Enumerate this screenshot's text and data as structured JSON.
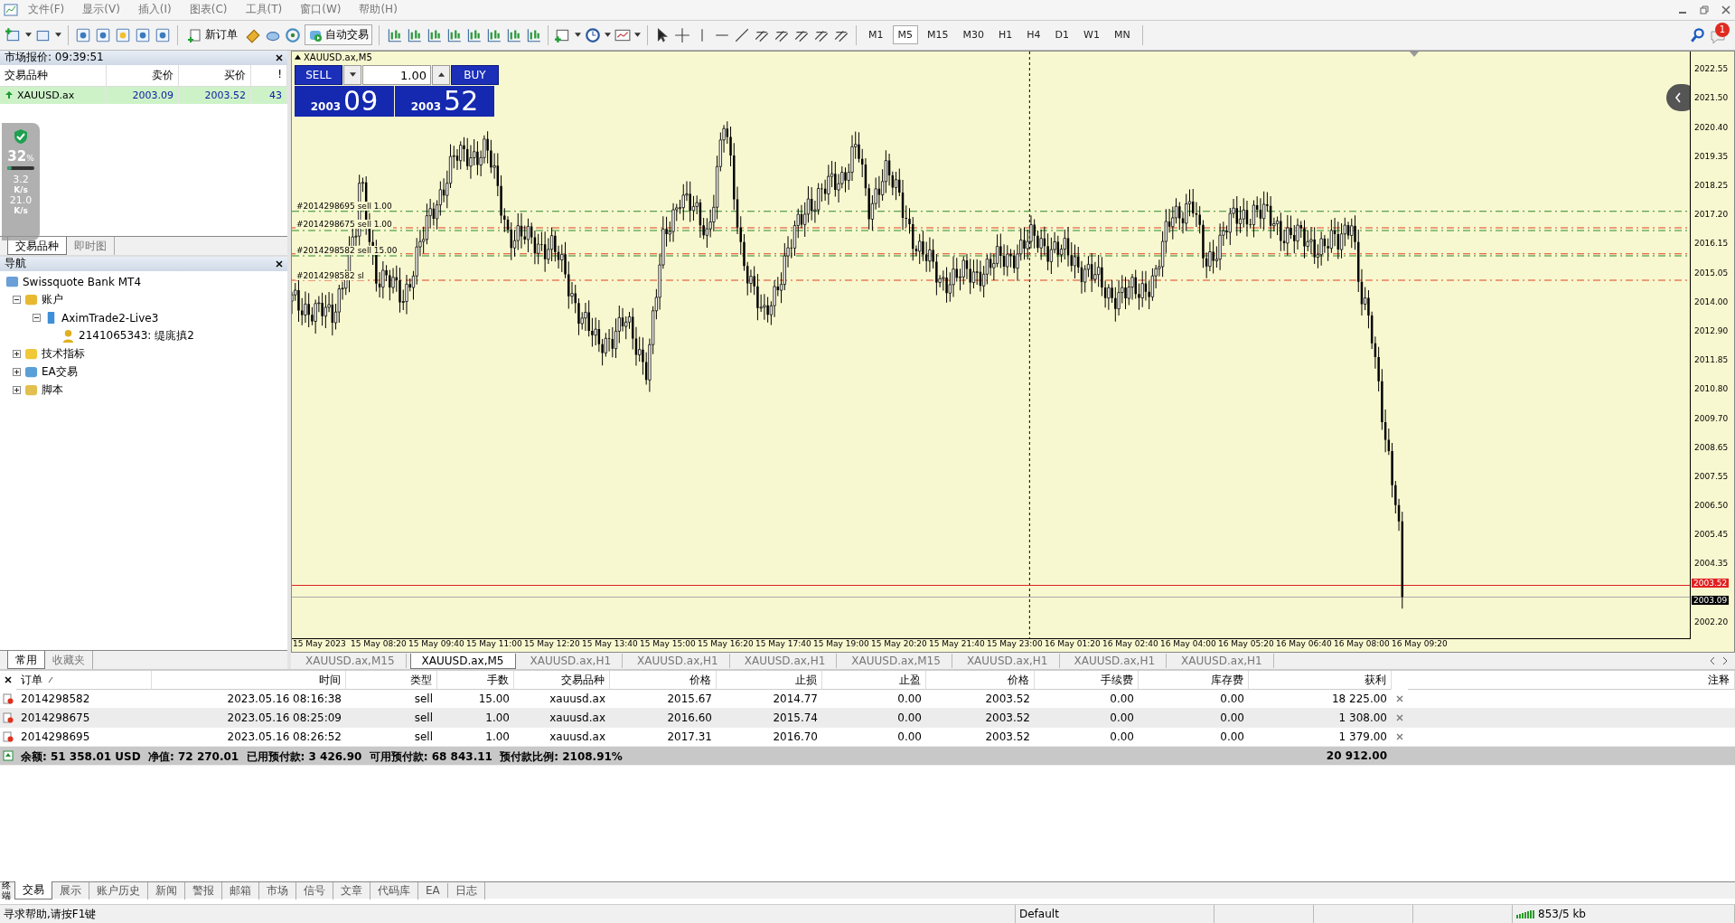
{
  "menu": [
    "文件(F)",
    "显示(V)",
    "插入(I)",
    "图表(C)",
    "工具(T)",
    "窗口(W)",
    "帮助(H)"
  ],
  "toolbar": {
    "new_order": "新订单",
    "auto_trading": "自动交易",
    "timeframes": [
      {
        "label": "M1",
        "selected": false
      },
      {
        "label": "M5",
        "selected": true
      },
      {
        "label": "M15",
        "selected": false
      },
      {
        "label": "M30",
        "selected": false
      },
      {
        "label": "H1",
        "selected": false
      },
      {
        "label": "H4",
        "selected": false
      },
      {
        "label": "D1",
        "selected": false
      },
      {
        "label": "W1",
        "selected": false
      },
      {
        "label": "MN",
        "selected": false
      }
    ],
    "notification_count": "1"
  },
  "market_watch": {
    "title": "市场报价: 09:39:51",
    "columns": [
      "交易品种",
      "卖价",
      "买价",
      "!"
    ],
    "rows": [
      {
        "symbol": "XAUUSD.ax",
        "bid": "2003.09",
        "ask": "2003.52",
        "spread": "43"
      }
    ],
    "tabs": [
      {
        "label": "交易品种",
        "selected": true
      },
      {
        "label": "即时图",
        "selected": false
      }
    ]
  },
  "network_monitor": {
    "percent": "32",
    "percent_unit": "%",
    "level": 0.15,
    "upload": "3.2",
    "upload_unit": "K/s",
    "download": "21.0",
    "download_unit": "K/s"
  },
  "navigator": {
    "title": "导航",
    "tree": [
      {
        "label": "Swissquote Bank MT4",
        "kind": "server",
        "children": [
          {
            "label": "账户",
            "kind": "accounts",
            "expanded": true,
            "children": [
              {
                "label": "AximTrade2-Live3",
                "kind": "broker",
                "expanded": true,
                "children": [
                  {
                    "label": "2141065343: 缇庣搷2",
                    "kind": "user"
                  }
                ]
              }
            ]
          },
          {
            "label": "技术指标",
            "kind": "indicators",
            "expanded": false
          },
          {
            "label": "EA交易",
            "kind": "experts",
            "expanded": false
          },
          {
            "label": "脚本",
            "kind": "scripts",
            "expanded": false
          }
        ]
      }
    ],
    "tabs": [
      {
        "label": "常用",
        "selected": true
      },
      {
        "label": "收藏夹",
        "selected": false
      }
    ]
  },
  "chart": {
    "title": "XAUUSD.ax,M5",
    "trade_panel": {
      "sell": "SELL",
      "buy": "BUY",
      "lots": "1.00",
      "bid_prefix": "2003",
      "bid_digits": "09",
      "ask_prefix": "2003",
      "ask_digits": "52"
    },
    "order_lines": [
      {
        "label": "#2014298695 sell 1.00"
      },
      {
        "label": "#2014298675 sell 1.00"
      },
      {
        "label": "#2014298582 sell 15.00"
      },
      {
        "label": "#2014298582 sl"
      }
    ],
    "price_axis": {
      "labels": [
        "2022.55",
        "2021.50",
        "2020.40",
        "2019.35",
        "2018.25",
        "2017.20",
        "2016.15",
        "2015.05",
        "2014.00",
        "2012.90",
        "2011.85",
        "2010.80",
        "2009.70",
        "2008.65",
        "2007.55",
        "2006.50",
        "2005.45",
        "2004.35",
        "2002.20"
      ],
      "ask_marker": "2003.52",
      "bid_marker": "2003.09"
    },
    "time_axis": [
      "15 May 2023",
      "15 May 08:20",
      "15 May 09:40",
      "15 May 11:00",
      "15 May 12:20",
      "15 May 13:40",
      "15 May 15:00",
      "15 May 16:20",
      "15 May 17:40",
      "15 May 19:00",
      "15 May 20:20",
      "15 May 21:40",
      "15 May 23:00",
      "16 May 01:20",
      "16 May 02:40",
      "16 May 04:00",
      "16 May 05:20",
      "16 May 06:40",
      "16 May 08:00",
      "16 May 09:20"
    ]
  },
  "chart_tabs": [
    {
      "label": "XAUUSD.ax,M15",
      "selected": false
    },
    {
      "label": "XAUUSD.ax,M5",
      "selected": true
    },
    {
      "label": "XAUUSD.ax,H1",
      "selected": false
    },
    {
      "label": "XAUUSD.ax,H1",
      "selected": false
    },
    {
      "label": "XAUUSD.ax,H1",
      "selected": false
    },
    {
      "label": "XAUUSD.ax,M15",
      "selected": false
    },
    {
      "label": "XAUUSD.ax,H1",
      "selected": false
    },
    {
      "label": "XAUUSD.ax,H1",
      "selected": false
    },
    {
      "label": "XAUUSD.ax,H1",
      "selected": false
    }
  ],
  "terminal": {
    "side_label": "终端",
    "columns": [
      "订单",
      "时间",
      "类型",
      "手数",
      "交易品种",
      "价格",
      "止损",
      "止盈",
      "价格",
      "手续费",
      "库存费",
      "获利",
      "注释"
    ],
    "rows": [
      {
        "order": "2014298582",
        "time": "2023.05.16 08:16:38",
        "type": "sell",
        "lots": "15.00",
        "symbol": "xauusd.ax",
        "open_price": "2015.67",
        "sl": "2014.77",
        "tp": "0.00",
        "price": "2003.52",
        "commission": "0.00",
        "swap": "0.00",
        "profit": "18 225.00"
      },
      {
        "order": "2014298675",
        "time": "2023.05.16 08:25:09",
        "type": "sell",
        "lots": "1.00",
        "symbol": "xauusd.ax",
        "open_price": "2016.60",
        "sl": "2015.74",
        "tp": "0.00",
        "price": "2003.52",
        "commission": "0.00",
        "swap": "0.00",
        "profit": "1 308.00"
      },
      {
        "order": "2014298695",
        "time": "2023.05.16 08:26:52",
        "type": "sell",
        "lots": "1.00",
        "symbol": "xauusd.ax",
        "open_price": "2017.31",
        "sl": "2016.70",
        "tp": "0.00",
        "price": "2003.52",
        "commission": "0.00",
        "swap": "0.00",
        "profit": "1 379.00"
      }
    ],
    "summary": {
      "text": "余额: 51 358.01 USD  净值: 72 270.01  已用预付款: 3 426.90  可用预付款: 68 843.11  预付款比例: 2108.91%",
      "profit": "20 912.00"
    },
    "tabs": [
      {
        "label": "交易",
        "selected": true
      },
      {
        "label": "展示",
        "selected": false
      },
      {
        "label": "账户历史",
        "selected": false
      },
      {
        "label": "新闻",
        "selected": false
      },
      {
        "label": "警报",
        "selected": false
      },
      {
        "label": "邮箱",
        "selected": false
      },
      {
        "label": "市场",
        "selected": false
      },
      {
        "label": "信号",
        "selected": false
      },
      {
        "label": "文章",
        "selected": false
      },
      {
        "label": "代码库",
        "selected": false
      },
      {
        "label": "EA",
        "selected": false
      },
      {
        "label": "日志",
        "selected": false
      }
    ]
  },
  "status_bar": {
    "help": "寻求帮助,请按F1键",
    "profile": "Default",
    "traffic": "853/5 kb"
  }
}
